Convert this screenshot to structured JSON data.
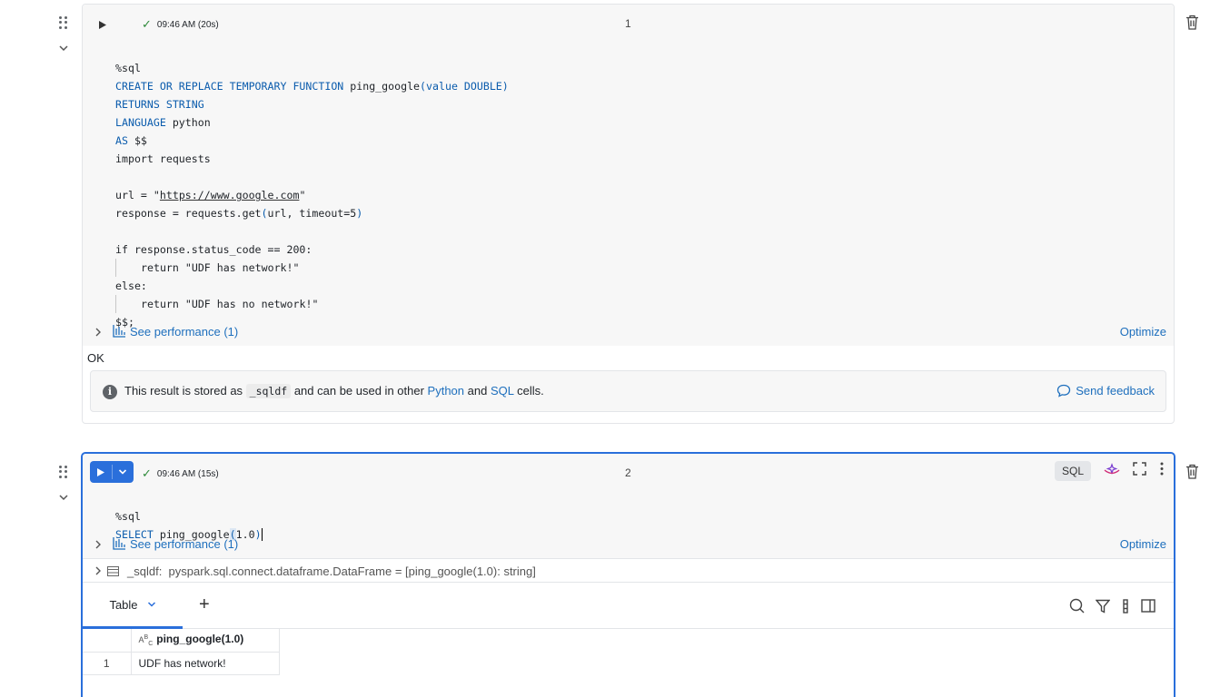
{
  "cell1": {
    "status_time": "09:46 AM (20s)",
    "cell_number": "1",
    "code": {
      "l1": "%sql",
      "l2_kw": "CREATE OR REPLACE TEMPORARY FUNCTION",
      "l2_name": " ping_google",
      "l2_open": "(",
      "l2_args": "value DOUBLE",
      "l2_close": ")",
      "l3": "RETURNS STRING",
      "l4_kw": "LANGUAGE",
      "l4_rest": " python",
      "l5_kw": "AS",
      "l5_rest": " $$",
      "l6": "import requests",
      "l8_pre": "url = \"",
      "l8_url": "https://www.google.com",
      "l8_post": "\"",
      "l9_pre": "response = requests.get",
      "l9_open": "(",
      "l9_args": "url, timeout=5",
      "l9_close": ")",
      "l11": "if response.status_code == 200:",
      "l12": "return \"UDF has network!\"",
      "l13": "else:",
      "l14": "return \"UDF has no network!\"",
      "l15": "$$;"
    },
    "see_performance": "See performance (1)",
    "optimize": "Optimize",
    "result": "OK",
    "info": {
      "pre": "This result is stored as ",
      "var": "_sqldf",
      "mid": " and can be used in other ",
      "python": "Python",
      "and": " and ",
      "sql": "SQL",
      "post": " cells.",
      "feedback": "Send feedback"
    }
  },
  "cell2": {
    "status_time": "09:46 AM (15s)",
    "cell_number": "2",
    "language": "SQL",
    "code": {
      "l1": "%sql",
      "l2_kw": "SELECT",
      "l2_name": " ping_google",
      "l2_open": "(",
      "l2_args": "1.0",
      "l2_close": ")"
    },
    "see_performance": "See performance (1)",
    "optimize": "Optimize",
    "df_label": "_sqldf:",
    "df_type": "pyspark.sql.connect.dataframe.DataFrame = [ping_google(1.0): string]",
    "tab_label": "Table",
    "table": {
      "column": "ping_google(1.0)",
      "rows": [
        {
          "n": "1",
          "value": "UDF has network!"
        }
      ]
    }
  },
  "icons": [
    "drag-handle-icon",
    "chevron-down-icon",
    "play-icon",
    "check-icon",
    "trash-icon",
    "bar-chart-icon",
    "info-icon",
    "chat-bubble-icon",
    "assistant-icon",
    "expand-icon",
    "kebab-menu-icon",
    "table-icon",
    "search-icon",
    "filter-icon",
    "column-settings-icon",
    "sidebar-panel-icon",
    "string-type-icon",
    "plus-icon"
  ],
  "colors": {
    "accent": "#2a6fdb",
    "link": "#1e6fbd",
    "keyword": "#0b5cad",
    "success": "#2f8a3b"
  }
}
